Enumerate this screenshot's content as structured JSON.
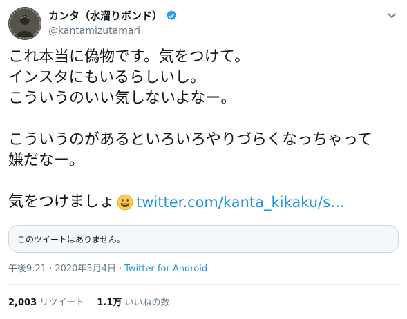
{
  "author": {
    "display_name": "カンタ（水溜りボンド）",
    "handle": "@kantamizutamari",
    "verified_icon": "verified-badge-icon",
    "avatar_icon": "avatar"
  },
  "tweet": {
    "line1": "これ本当に偽物です。気をつけて。",
    "line2": "インスタにもいるらしいし。",
    "line3": "こういうのいい気しないよなー。",
    "line4": "こういうのがあるといろいろやりづらくなっちゃって",
    "line5": "嫌だなー。",
    "line6_text": "気をつけましょ",
    "emoji": "grinning-face-emoji",
    "link": "twitter.com/kanta_kikaku/s…"
  },
  "quote_card": {
    "text": "このツイートはありません。"
  },
  "meta": {
    "time": "午後9:21",
    "separator": "·",
    "date": "2020年5月4日",
    "separator2": "·",
    "source": "Twitter for Android"
  },
  "stats": {
    "retweets_count": "2,003",
    "retweets_label": "リツイート",
    "likes_count": "1.1万",
    "likes_label": "いいねの数"
  },
  "colors": {
    "link": "#1b95e0",
    "text": "#14171a",
    "secondary": "#657786",
    "card_border": "#ccd6dd",
    "card_bg": "#f5f8fa"
  }
}
